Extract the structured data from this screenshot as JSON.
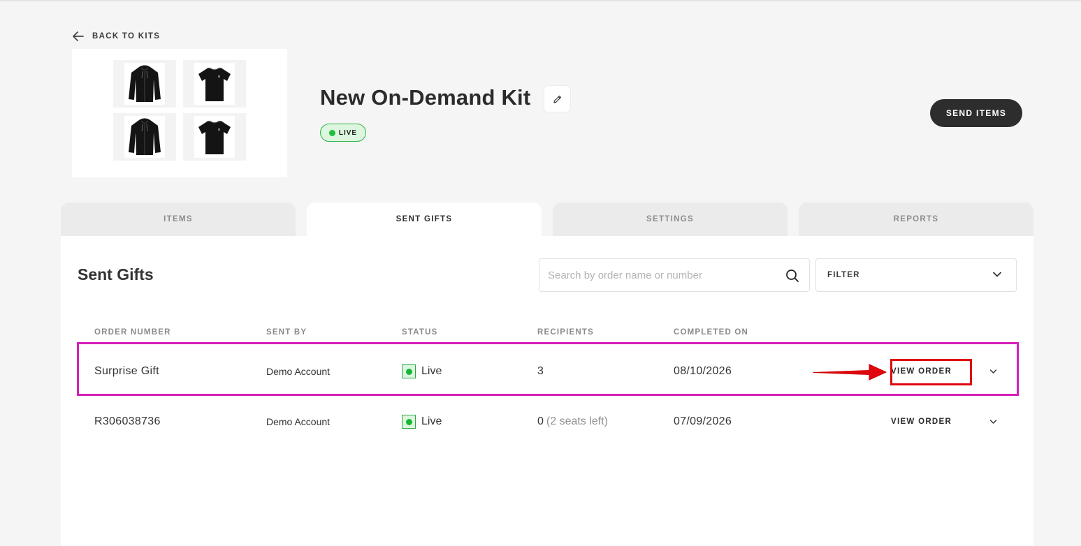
{
  "nav": {
    "back_label": "BACK TO KITS"
  },
  "kit": {
    "title": "New On-Demand Kit",
    "status_badge": "LIVE",
    "thumbnails": [
      "hoodie-black",
      "tshirt-black",
      "hoodie-black",
      "tshirt-black"
    ]
  },
  "header": {
    "send_label": "SEND ITEMS"
  },
  "tabs": [
    {
      "label": "ITEMS",
      "active": false
    },
    {
      "label": "SENT GIFTS",
      "active": true
    },
    {
      "label": "SETTINGS",
      "active": false
    },
    {
      "label": "REPORTS",
      "active": false
    }
  ],
  "section": {
    "title": "Sent Gifts",
    "search_placeholder": "Search by order name or number",
    "filter_label": "FILTER"
  },
  "table": {
    "columns": [
      "ORDER NUMBER",
      "SENT BY",
      "STATUS",
      "RECIPIENTS",
      "COMPLETED ON"
    ],
    "rows": [
      {
        "order": "Surprise Gift",
        "sent_by": "Demo Account",
        "status": "Live",
        "recipients": "3",
        "recipients_note": "",
        "completed": "08/10/2026",
        "action": "VIEW ORDER"
      },
      {
        "order": "R306038736",
        "sent_by": "Demo Account",
        "status": "Live",
        "recipients": "0",
        "recipients_note": "(2 seats left)",
        "completed": "07/09/2026",
        "action": "VIEW ORDER"
      }
    ]
  },
  "colors": {
    "live_green": "#1fbf3a",
    "annotation_row": "#d61fb9",
    "annotation_button": "#e0060f",
    "dark_button": "#2d2d2d"
  }
}
